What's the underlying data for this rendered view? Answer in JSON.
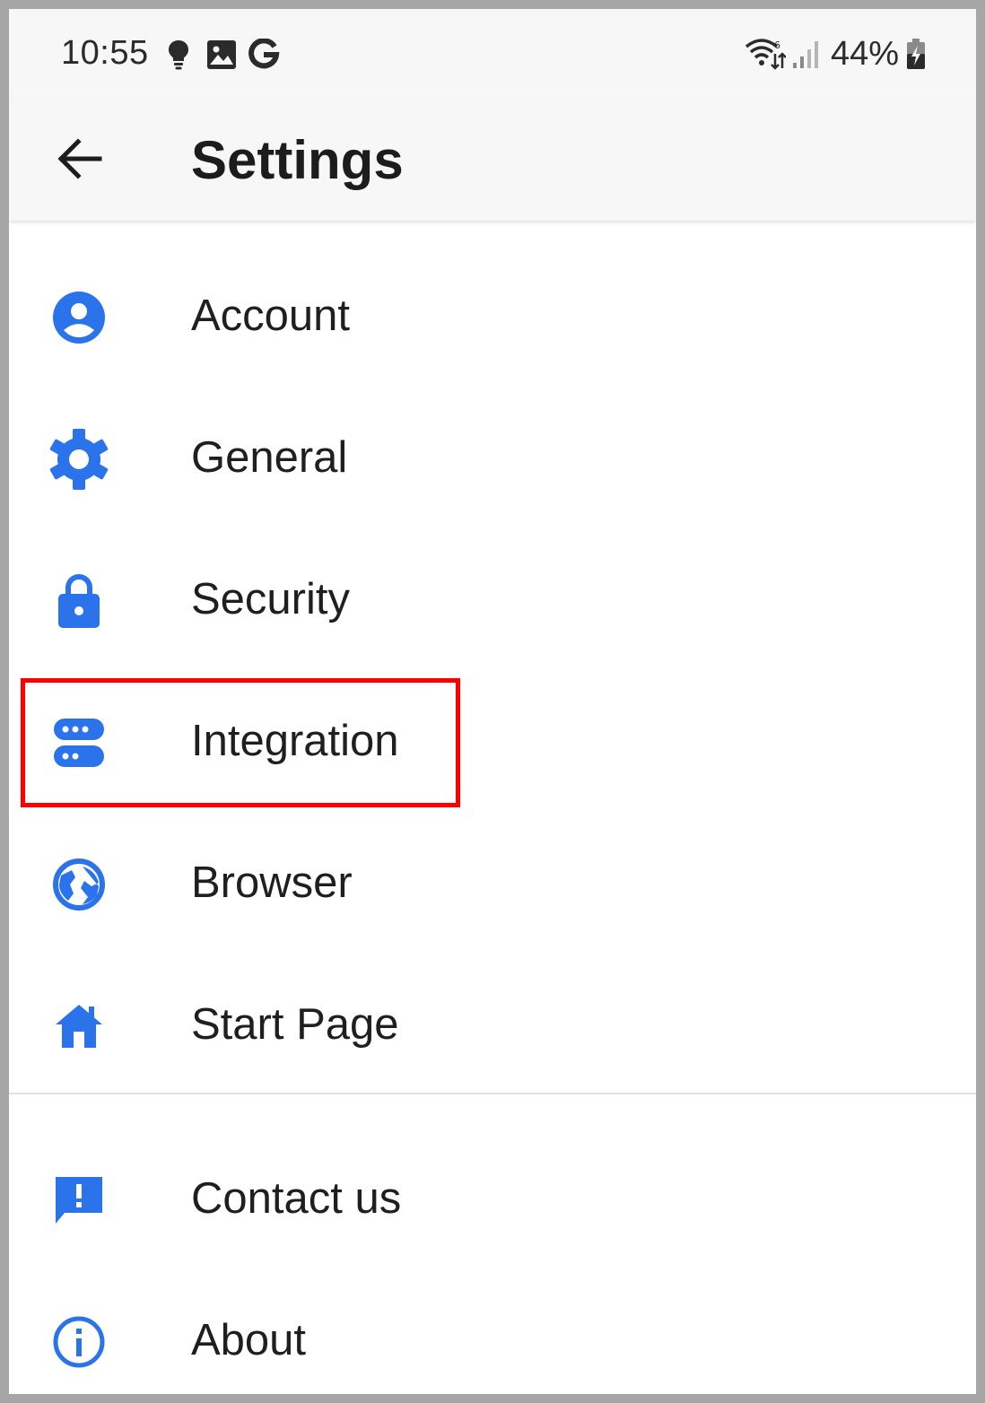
{
  "status_bar": {
    "time": "10:55",
    "battery": "44%",
    "icons": [
      "bulb-icon",
      "image-icon",
      "google-g-icon",
      "wifi-icon",
      "signal-icon",
      "battery-charging-icon"
    ]
  },
  "app_bar": {
    "title": "Settings",
    "back_icon": "arrow-left-icon"
  },
  "accent_color": "#2a73eb",
  "highlight_color": "#ff0000",
  "menu": {
    "items": [
      {
        "label": "Account",
        "icon": "account-circle-icon"
      },
      {
        "label": "General",
        "icon": "gear-icon"
      },
      {
        "label": "Security",
        "icon": "lock-icon"
      },
      {
        "label": "Integration",
        "icon": "integration-icon",
        "highlighted": true
      },
      {
        "label": "Browser",
        "icon": "globe-icon"
      },
      {
        "label": "Start Page",
        "icon": "home-icon"
      }
    ],
    "secondary": [
      {
        "label": "Contact us",
        "icon": "feedback-icon"
      },
      {
        "label": "About",
        "icon": "info-icon"
      }
    ]
  }
}
